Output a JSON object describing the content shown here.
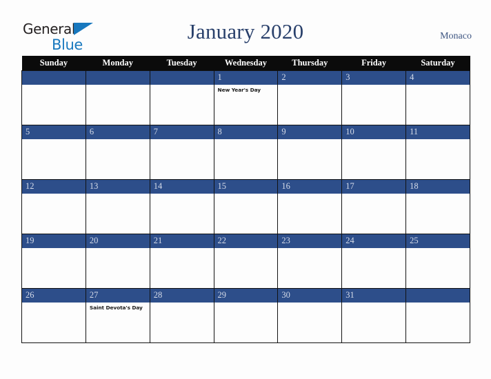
{
  "brand": {
    "name_part1": "General",
    "name_part2": "Blue",
    "triangle_icon": "triangle-icon",
    "color_dark": "#231f20",
    "color_blue": "#1878be"
  },
  "header": {
    "title": "January 2020",
    "locale": "Monaco",
    "title_color": "#29406b"
  },
  "calendar": {
    "weekday_headers": [
      "Sunday",
      "Monday",
      "Tuesday",
      "Wednesday",
      "Thursday",
      "Friday",
      "Saturday"
    ],
    "header_bg": "#0b0b0b",
    "daynum_bg": "#2d4e8a",
    "daynum_color": "#d5dbe8",
    "cell_bg": "#fdfdfd",
    "border_color": "#111111",
    "weeks": [
      [
        {
          "day": "",
          "event": ""
        },
        {
          "day": "",
          "event": ""
        },
        {
          "day": "",
          "event": ""
        },
        {
          "day": "1",
          "event": "New Year's Day"
        },
        {
          "day": "2",
          "event": ""
        },
        {
          "day": "3",
          "event": ""
        },
        {
          "day": "4",
          "event": ""
        }
      ],
      [
        {
          "day": "5",
          "event": ""
        },
        {
          "day": "6",
          "event": ""
        },
        {
          "day": "7",
          "event": ""
        },
        {
          "day": "8",
          "event": ""
        },
        {
          "day": "9",
          "event": ""
        },
        {
          "day": "10",
          "event": ""
        },
        {
          "day": "11",
          "event": ""
        }
      ],
      [
        {
          "day": "12",
          "event": ""
        },
        {
          "day": "13",
          "event": ""
        },
        {
          "day": "14",
          "event": ""
        },
        {
          "day": "15",
          "event": ""
        },
        {
          "day": "16",
          "event": ""
        },
        {
          "day": "17",
          "event": ""
        },
        {
          "day": "18",
          "event": ""
        }
      ],
      [
        {
          "day": "19",
          "event": ""
        },
        {
          "day": "20",
          "event": ""
        },
        {
          "day": "21",
          "event": ""
        },
        {
          "day": "22",
          "event": ""
        },
        {
          "day": "23",
          "event": ""
        },
        {
          "day": "24",
          "event": ""
        },
        {
          "day": "25",
          "event": ""
        }
      ],
      [
        {
          "day": "26",
          "event": ""
        },
        {
          "day": "27",
          "event": "Saint Devota's Day"
        },
        {
          "day": "28",
          "event": ""
        },
        {
          "day": "29",
          "event": ""
        },
        {
          "day": "30",
          "event": ""
        },
        {
          "day": "31",
          "event": ""
        },
        {
          "day": "",
          "event": ""
        }
      ]
    ]
  }
}
